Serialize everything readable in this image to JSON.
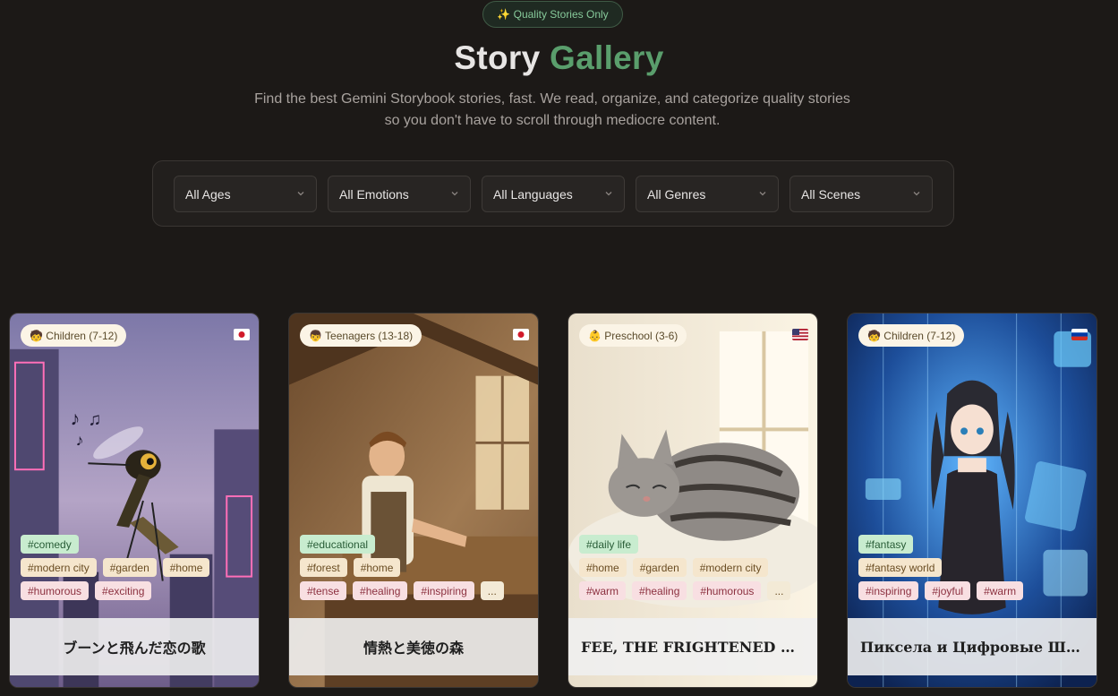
{
  "badge": "✨ Quality Stories Only",
  "hero": {
    "title_part1": "Story",
    "title_part2": "Gallery",
    "subtitle": "Find the best Gemini Storybook stories, fast. We read, organize, and categorize quality stories so you don't have to scroll through mediocre content."
  },
  "filters": [
    "All Ages",
    "All Emotions",
    "All Languages",
    "All Genres",
    "All Scenes"
  ],
  "stories": [
    {
      "age": "🧒 Children (7-12)",
      "flag": "jp",
      "tags_row1": [
        "#comedy"
      ],
      "tags_row2": [
        "#modern city",
        "#garden",
        "#home"
      ],
      "tags_row3": [
        "#humorous",
        "#exciting"
      ],
      "title": "ブーンと飛んだ恋の歌"
    },
    {
      "age": "👦 Teenagers (13-18)",
      "flag": "jp",
      "tags_row1": [
        "#educational"
      ],
      "tags_row2": [
        "#forest",
        "#home"
      ],
      "tags_row3": [
        "#tense",
        "#healing",
        "#inspiring",
        "..."
      ],
      "title": "情熱と美徳の森"
    },
    {
      "age": "👶 Preschool (3-6)",
      "flag": "us",
      "tags_row1": [
        "#daily life"
      ],
      "tags_row2": [
        "#home",
        "#garden",
        "#modern city"
      ],
      "tags_row3": [
        "#warm",
        "#healing",
        "#humorous",
        "..."
      ],
      "title": "FEE, THE FRIGHTENED CAT"
    },
    {
      "age": "🧒 Children (7-12)",
      "flag": "ru",
      "tags_row1": [
        "#fantasy"
      ],
      "tags_row2": [
        "#fantasy world"
      ],
      "tags_row3": [
        "#inspiring",
        "#joyful",
        "#warm"
      ],
      "title": "Пиксела и Цифровые Шедевры"
    }
  ],
  "colors": {
    "background": "#1c1917",
    "accent_green": "#5a9e6c",
    "tag_genre": "#c8eccf",
    "tag_scene": "#f5e6cd",
    "tag_emotion": "#f8dfe2"
  }
}
